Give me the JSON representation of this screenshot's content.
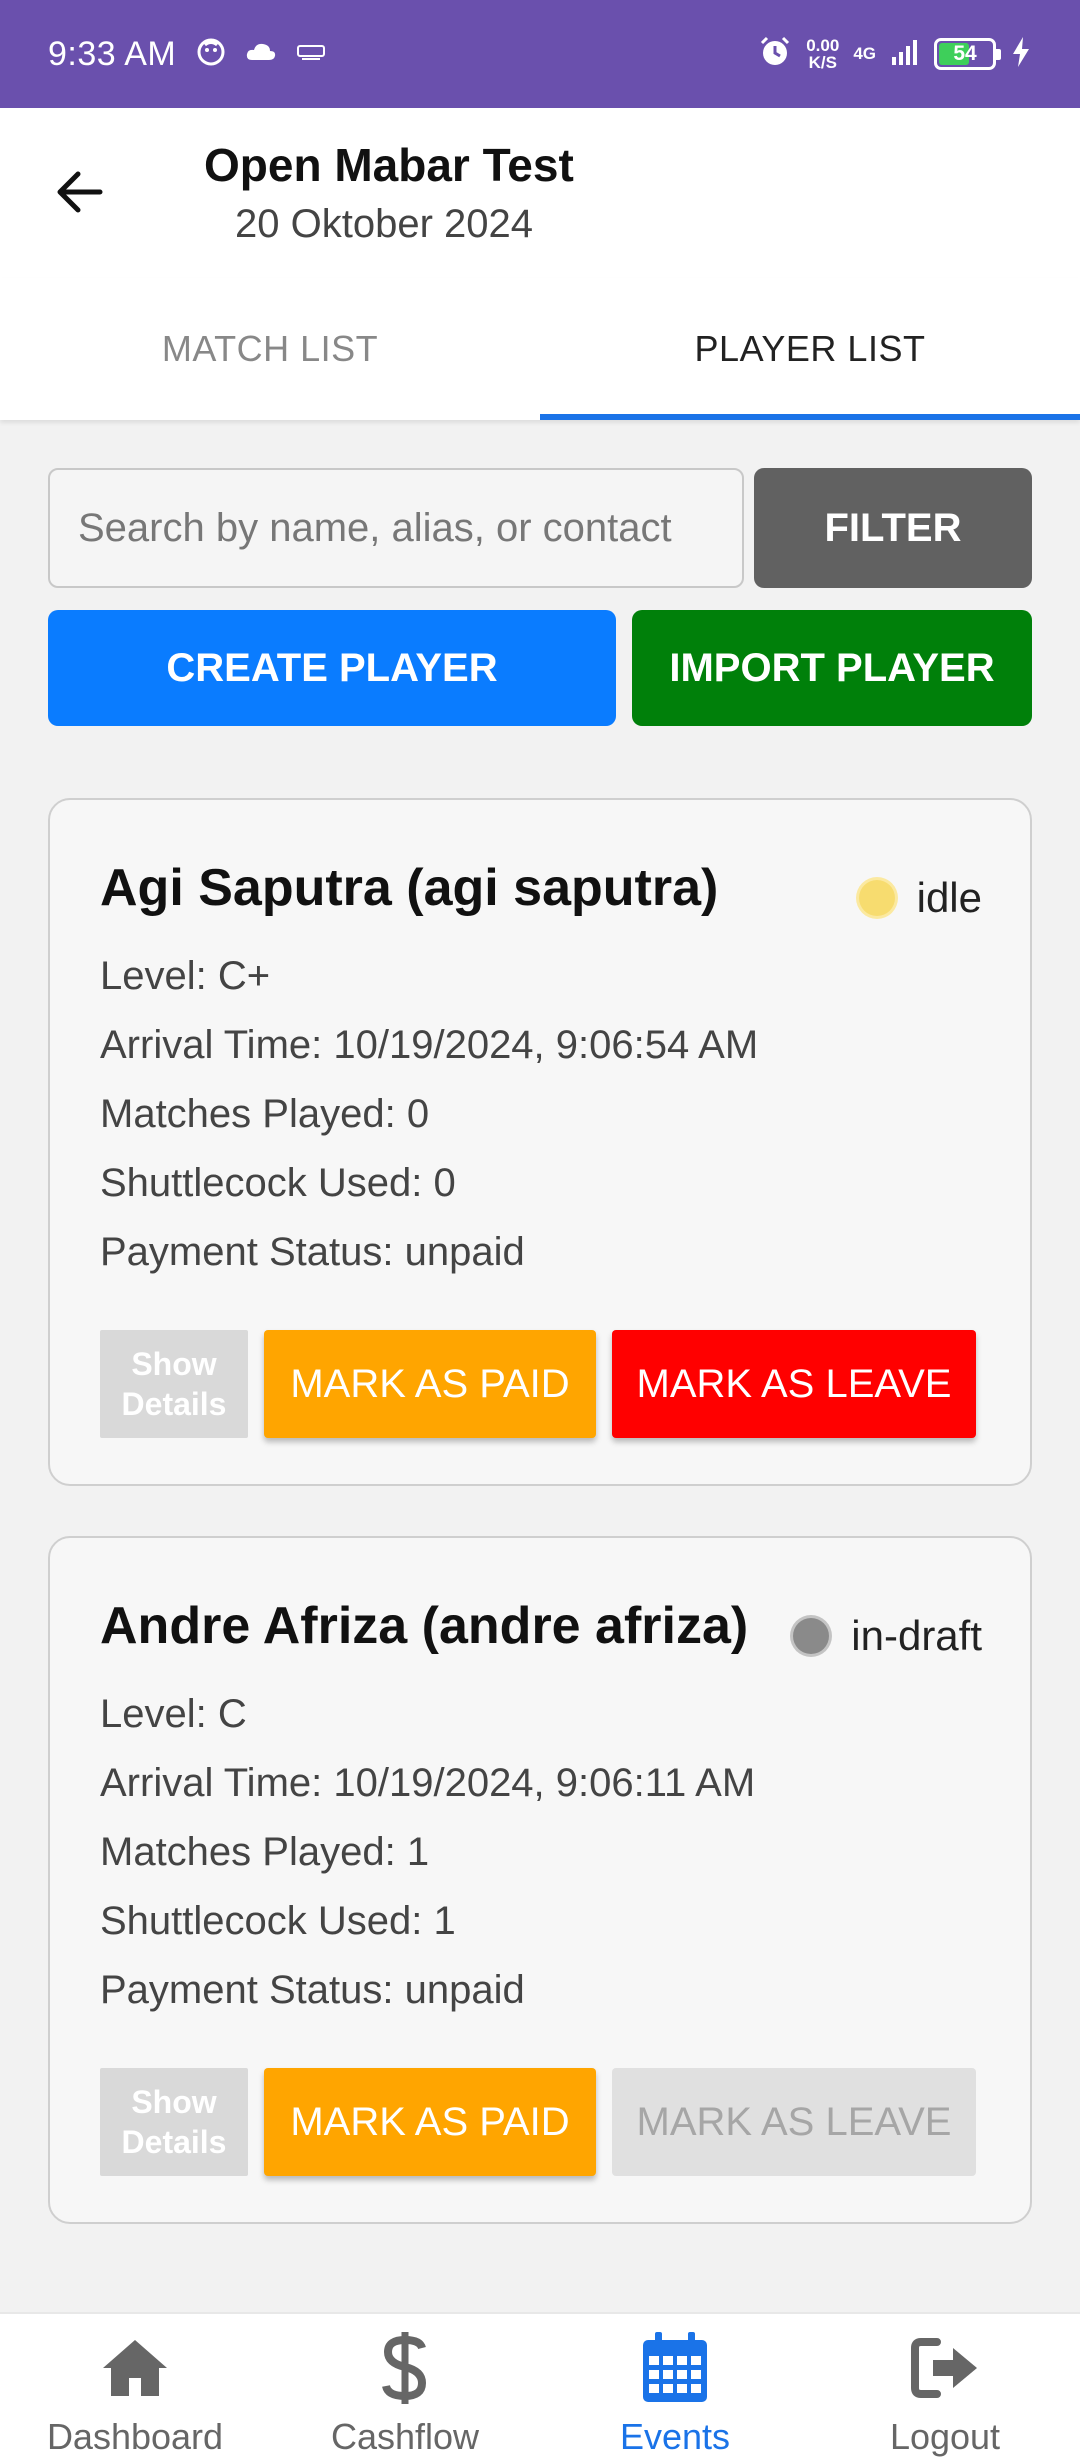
{
  "status_bar": {
    "time": "9:33 AM",
    "speed_top": "0.00",
    "speed_bottom": "K/S",
    "network": "4G",
    "battery": "54",
    "left_icons": [
      "face-icon",
      "cloud-icon",
      "cnn-icon"
    ],
    "right_icons": [
      "alarm-icon",
      "signal-icon",
      "battery-icon",
      "charging-icon"
    ]
  },
  "header": {
    "title": "Open Mabar Test",
    "date": "20 Oktober 2024",
    "back_icon": "arrow-left-icon"
  },
  "tabs": [
    {
      "label": "MATCH LIST",
      "active": false
    },
    {
      "label": "PLAYER LIST",
      "active": true
    }
  ],
  "search": {
    "placeholder": "Search by name, alias, or contact",
    "value": ""
  },
  "buttons": {
    "filter": "FILTER",
    "create": "CREATE PLAYER",
    "import": "IMPORT PLAYER"
  },
  "players": [
    {
      "name": "Agi Saputra (agi saputra)",
      "status": "idle",
      "status_color": "#f7dc6f",
      "level": "Level: C+",
      "arrival": "Arrival Time: 10/19/2024, 9:06:54 AM",
      "matches": "Matches Played: 0",
      "shuttlecock": "Shuttlecock Used: 0",
      "payment": "Payment Status: unpaid",
      "show_details": "Show Details",
      "mark_paid": "MARK AS PAID",
      "mark_leave": "MARK AS LEAVE",
      "leave_enabled": true
    },
    {
      "name": "Andre Afriza (andre afriza)",
      "status": "in-draft",
      "status_color": "#8a8a8a",
      "level": "Level: C",
      "arrival": "Arrival Time: 10/19/2024, 9:06:11 AM",
      "matches": "Matches Played: 1",
      "shuttlecock": "Shuttlecock Used: 1",
      "payment": "Payment Status: unpaid",
      "show_details": "Show Details",
      "mark_paid": "MARK AS PAID",
      "mark_leave": "MARK AS LEAVE",
      "leave_enabled": false
    }
  ],
  "bottom_nav": [
    {
      "label": "Dashboard",
      "icon": "home-icon",
      "active": false
    },
    {
      "label": "Cashflow",
      "icon": "dollar-icon",
      "active": false
    },
    {
      "label": "Events",
      "icon": "calendar-icon",
      "active": true
    },
    {
      "label": "Logout",
      "icon": "logout-icon",
      "active": false
    }
  ],
  "colors": {
    "status_bar": "#6a50ad",
    "accent": "#1a73e8",
    "create": "#0a7cff",
    "import": "#00800a",
    "paid": "#ffa500",
    "leave": "#ff0000"
  }
}
